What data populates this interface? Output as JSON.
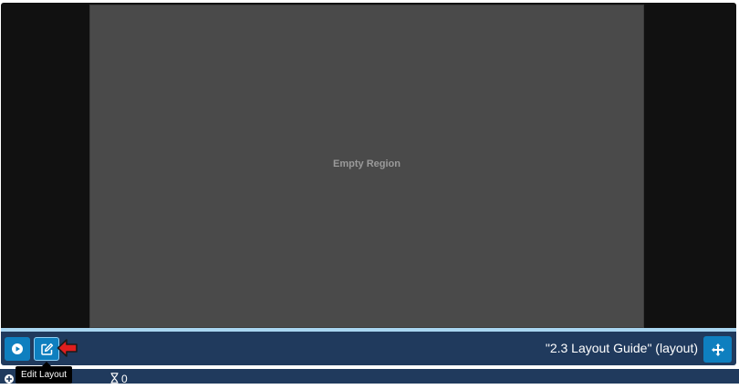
{
  "viewer": {
    "region_label": "Empty Region"
  },
  "toolbar": {
    "layout_title": "\"2.3 Layout Guide\" (layout)",
    "buttons": [
      {
        "name": "preview-button",
        "icon": "play-circle-icon"
      },
      {
        "name": "edit-layout-button",
        "icon": "edit-icon"
      },
      {
        "name": "move-button",
        "icon": "arrows-move-icon"
      }
    ]
  },
  "tooltip": {
    "text": "Edit Layout"
  },
  "bottom_bar": {
    "count": "0",
    "count_icon": "hourglass-icon"
  },
  "colors": {
    "toolbar_bg": "#203a5d",
    "button_bg": "#0e7fbf",
    "viewer_bg": "#111111",
    "region_bg": "#4a4a4a",
    "pointer_arrow": "#e01e1e"
  }
}
